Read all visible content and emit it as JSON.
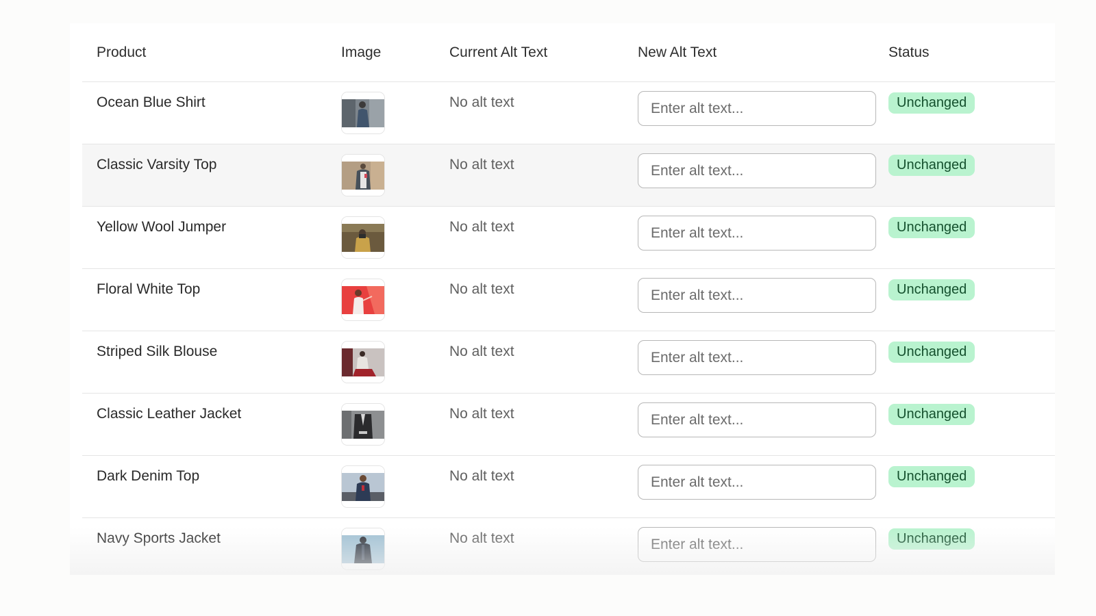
{
  "table": {
    "headers": {
      "product": "Product",
      "image": "Image",
      "current_alt": "Current Alt Text",
      "new_alt": "New Alt Text",
      "status": "Status"
    },
    "rows": [
      {
        "product": "Ocean Blue Shirt",
        "current_alt": "No alt text",
        "new_alt_value": "",
        "placeholder": "Enter alt text...",
        "status": "Unchanged",
        "image_icon": "product-photo-icon"
      },
      {
        "product": "Classic Varsity Top",
        "current_alt": "No alt text",
        "new_alt_value": "",
        "placeholder": "Enter alt text...",
        "status": "Unchanged",
        "image_icon": "product-photo-icon"
      },
      {
        "product": "Yellow Wool Jumper",
        "current_alt": "No alt text",
        "new_alt_value": "",
        "placeholder": "Enter alt text...",
        "status": "Unchanged",
        "image_icon": "product-photo-icon"
      },
      {
        "product": "Floral White Top",
        "current_alt": "No alt text",
        "new_alt_value": "",
        "placeholder": "Enter alt text...",
        "status": "Unchanged",
        "image_icon": "product-photo-icon"
      },
      {
        "product": "Striped Silk Blouse",
        "current_alt": "No alt text",
        "new_alt_value": "",
        "placeholder": "Enter alt text...",
        "status": "Unchanged",
        "image_icon": "product-photo-icon"
      },
      {
        "product": "Classic Leather Jacket",
        "current_alt": "No alt text",
        "new_alt_value": "",
        "placeholder": "Enter alt text...",
        "status": "Unchanged",
        "image_icon": "product-photo-icon"
      },
      {
        "product": "Dark Denim Top",
        "current_alt": "No alt text",
        "new_alt_value": "",
        "placeholder": "Enter alt text...",
        "status": "Unchanged",
        "image_icon": "product-photo-icon"
      },
      {
        "product": "Navy Sports Jacket",
        "current_alt": "No alt text",
        "new_alt_value": "",
        "placeholder": "Enter alt text...",
        "status": "Unchanged",
        "image_icon": "product-photo-icon"
      }
    ]
  },
  "colors": {
    "status_badge_bg": "#b9f3cf",
    "status_badge_text": "#14502d",
    "alt_row_bg": "#f6f6f6",
    "divider": "#e5e5e5"
  }
}
